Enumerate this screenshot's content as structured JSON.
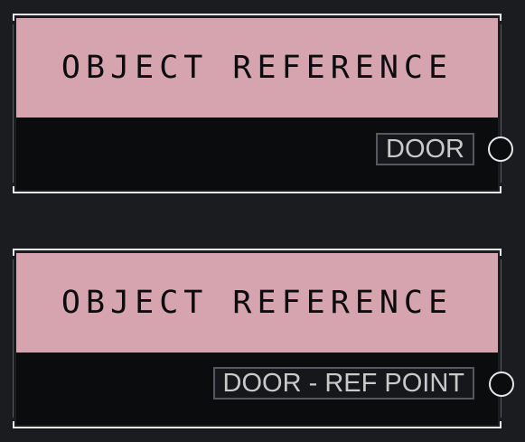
{
  "nodes": [
    {
      "title": "OBJECT REFERENCE",
      "output_label": "DOOR",
      "header_color": "#d5a4ae"
    },
    {
      "title": "OBJECT REFERENCE",
      "output_label": "DOOR - REF POINT",
      "header_color": "#d5a4ae"
    }
  ],
  "icons": {
    "output_port": "circle-port-icon"
  }
}
